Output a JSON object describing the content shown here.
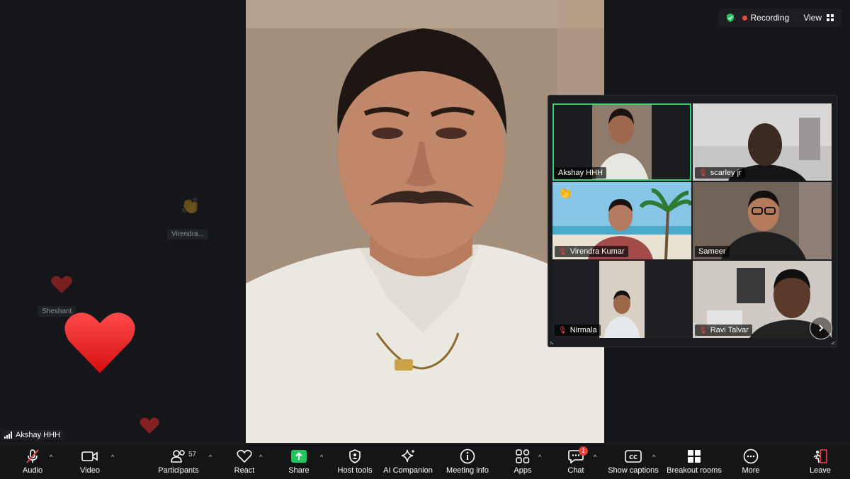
{
  "top_bar": {
    "recording_label": "Recording",
    "view_label": "View"
  },
  "main_speaker": {
    "name": "Akshay HHH"
  },
  "reactions": [
    {
      "name": "Virendra..."
    },
    {
      "name": "Sheshant"
    }
  ],
  "gallery": {
    "tiles": [
      {
        "name": "Akshay HHH",
        "muted": false,
        "active": true
      },
      {
        "name": "scarley jr",
        "muted": true,
        "active": false
      },
      {
        "name": "Virendra Kumar",
        "muted": true,
        "active": false
      },
      {
        "name": "Sameer",
        "muted": false,
        "active": false
      },
      {
        "name": "Nirmala",
        "muted": true,
        "active": false
      },
      {
        "name": "Ravi Talvar",
        "muted": true,
        "active": false
      }
    ]
  },
  "toolbar": {
    "audio": "Audio",
    "video": "Video",
    "participants": "Participants",
    "participants_count": "57",
    "react": "React",
    "share": "Share",
    "host_tools": "Host tools",
    "ai_companion": "AI Companion",
    "meeting_info": "Meeting info",
    "apps": "Apps",
    "chat": "Chat",
    "chat_badge": "1",
    "show_captions": "Show captions",
    "breakout_rooms": "Breakout rooms",
    "more": "More",
    "leave": "Leave"
  },
  "colors": {
    "active_border": "#2fd36d",
    "share_green": "#22c55e",
    "muted_red": "#e5484d",
    "leave_red": "#e53e3e"
  }
}
